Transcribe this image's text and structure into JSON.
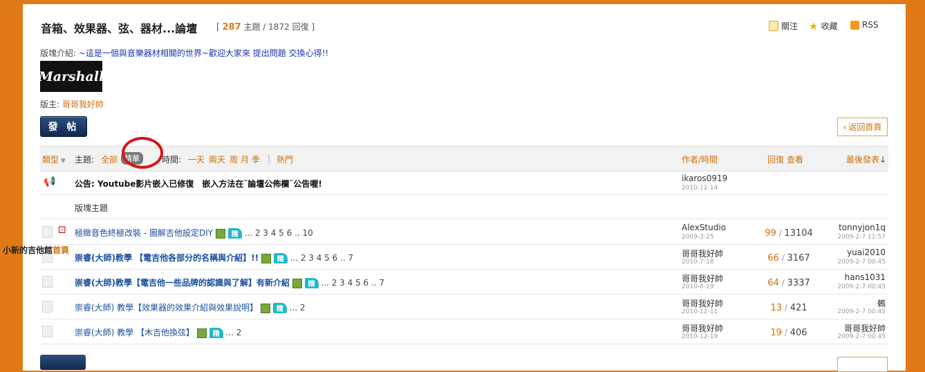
{
  "forum": {
    "title": "音箱、效果器、弦、器材...論壇",
    "count_open": "[",
    "topics_count": "287",
    "topics_label": "主題 /",
    "replies_count": "1872",
    "replies_label": "回復 ]",
    "actions": {
      "follow": "關注",
      "favorite": "收藏",
      "rss": "RSS"
    },
    "intro_label": "版塊介紹:",
    "intro_text": "~這是一個與音樂器材相關的世界~歡迎大家來 提出問題 交換心得!!",
    "logo_text": "Marshall",
    "moderator_label": "版主:",
    "moderator": "哥哥我好帥",
    "post_button": "發 帖",
    "back_home": "返回首頁"
  },
  "filters": {
    "type_label": "類型",
    "topic_label": "主題:",
    "topic_all": "全部",
    "topic_featured": "精華",
    "time_label": "時間:",
    "time_options": [
      "一天",
      "兩天",
      "周",
      "月",
      "季"
    ],
    "separator": "|",
    "hot": "熱門"
  },
  "columns": {
    "author_time": "作者/時間",
    "replies": "回復",
    "views": "查看",
    "last_post": "最後發表"
  },
  "announcement": {
    "prefix": "公告:",
    "text": "Youtube影片嵌入已修復　嵌入方法在˘論壇公佈欄˘公告喔!",
    "author": "ikaros0919",
    "date": "2010-12-14"
  },
  "section_label": "版塊主題",
  "threads": [
    {
      "title": "極緻音色終極改裝 - 圖解吉他設定DIY",
      "bold": false,
      "badge_jing": "精",
      "pages": "... 2  3  4  5  6 .. 10",
      "author": "AlexStudio",
      "date": "2009-3-25",
      "replies": "99",
      "views": "13104",
      "last_user": "tonnyjon1q",
      "last_time": "2009-2-7 11:57"
    },
    {
      "title": "崇睿(大師)教學 【電吉他各部分的名稱與介紹】!!",
      "bold": true,
      "badge_jing": "精",
      "pages": "... 2  3  4  5  6 .. 7",
      "author": "哥哥我好帥",
      "date": "2010-7-18",
      "replies": "66",
      "views": "3167",
      "last_user": "yuai2010",
      "last_time": "2009-2-7 00:45"
    },
    {
      "title": "崇睿(大師)教學【電吉他一些品牌的認識與了解】有新介紹",
      "bold": true,
      "badge_jing": "精",
      "pages": "... 2  3  4  5  6 .. 7",
      "author": "哥哥我好帥",
      "date": "2010-8-19",
      "replies": "64",
      "views": "3337",
      "last_user": "hans1031",
      "last_time": "2009-2-7 00:45"
    },
    {
      "title": "崇睿(大師) 教學【效果器的效果介紹與效果說明】",
      "bold": false,
      "badge_jing": "精",
      "pages": "... 2",
      "author": "哥哥我好帥",
      "date": "2010-12-11",
      "replies": "13",
      "views": "421",
      "last_user": "鶇",
      "last_time": "2009-2-7 00:45"
    },
    {
      "title": "崇睿(大師) 教學 【木吉他換弦】",
      "bold": false,
      "badge_jing": "精",
      "pages": "... 2",
      "author": "哥哥我好帥",
      "date": "2010-12-19",
      "replies": "19",
      "views": "406",
      "last_user": "哥哥我好帥",
      "last_time": "2009-2-7 00:45"
    }
  ],
  "overlay": {
    "site": "小新的吉他館",
    "home": "首頁"
  },
  "colors": {
    "accent": "#e07a16",
    "link": "#1a4fa0",
    "highlight_ring": "#d8141a"
  },
  "icons": [
    "follow-icon",
    "star-icon",
    "rss-icon",
    "megaphone-icon",
    "folder-icon",
    "dice-icon",
    "image-icon",
    "featured-badge-icon"
  ]
}
